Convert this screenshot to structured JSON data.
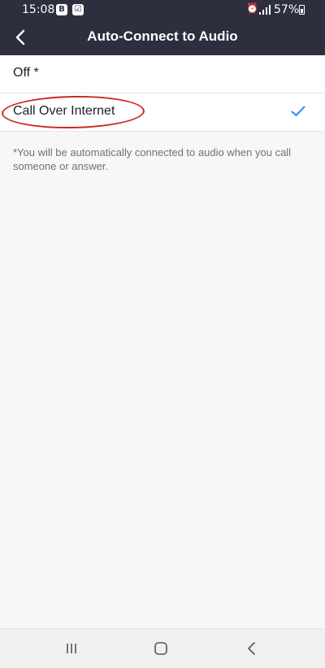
{
  "status_bar": {
    "time": "15:08",
    "app_badges": [
      "B",
      "☑"
    ],
    "battery_percent": "57%"
  },
  "header": {
    "title": "Auto-Connect to Audio",
    "back_icon": "chevron-left-icon"
  },
  "options": [
    {
      "label": "Off *",
      "selected": false
    },
    {
      "label": "Call Over Internet",
      "selected": true
    }
  ],
  "note": "*You will be automatically connected to audio when you call someone or answer.",
  "colors": {
    "header_bg": "#2d2f3e",
    "check": "#2d8cff",
    "annotation": "#cc2a1f"
  }
}
